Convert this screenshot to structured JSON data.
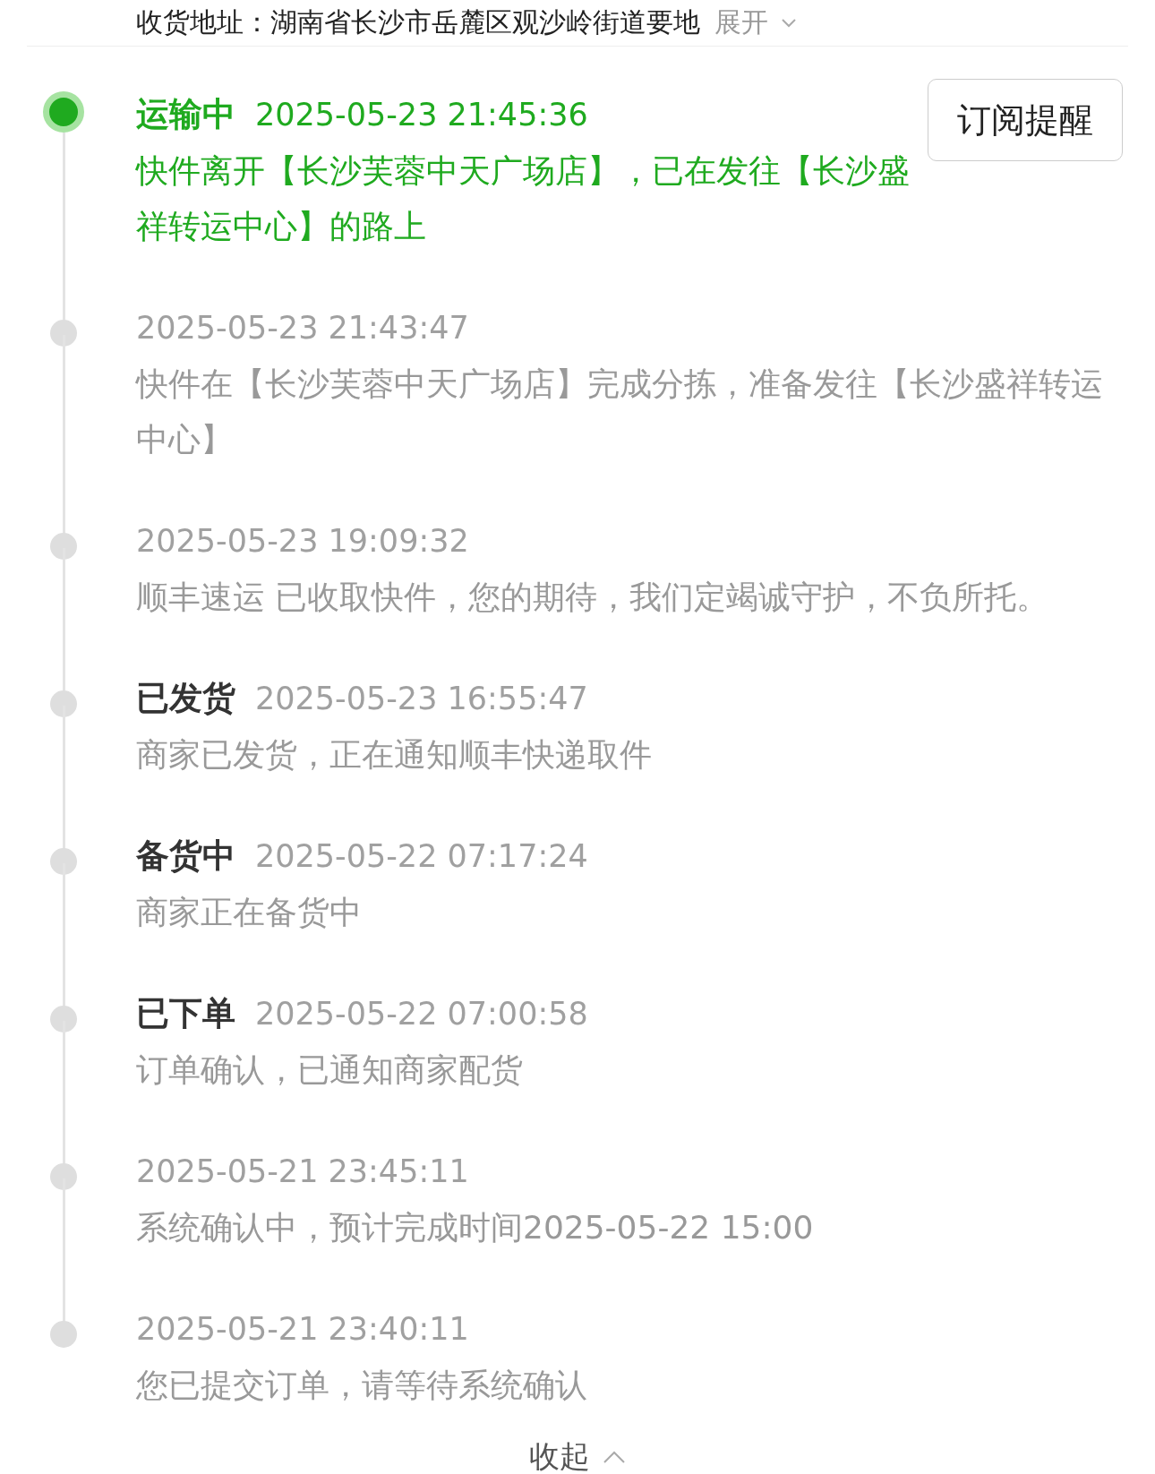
{
  "address": {
    "text": "收货地址：湖南省长沙市岳麓区观沙岭街道要地",
    "expand": "展开"
  },
  "subscribe_button": "订阅提醒",
  "events": [
    {
      "status": "运输中",
      "time": "2025-05-23 21:45:36",
      "description": "快件离开【长沙芙蓉中天广场店】，已在发往【长沙盛祥转运中心】的路上",
      "selected": true
    },
    {
      "time": "2025-05-23 21:43:47",
      "description": "快件在【长沙芙蓉中天广场店】完成分拣，准备发往【长沙盛祥转运中心】",
      "selected": false
    },
    {
      "time": "2025-05-23 19:09:32",
      "description": "顺丰速运 已收取快件，您的期待，我们定竭诚守护，不负所托。",
      "selected": false
    },
    {
      "status": "已发货",
      "time": "2025-05-23 16:55:47",
      "description": "商家已发货，正在通知顺丰快递取件",
      "selected": false
    },
    {
      "status": "备货中",
      "time": "2025-05-22 07:17:24",
      "description": "商家正在备货中",
      "selected": false
    },
    {
      "status": "已下单",
      "time": "2025-05-22 07:00:58",
      "description": "订单确认，已通知商家配货",
      "selected": false
    },
    {
      "time": "2025-05-21 23:45:11",
      "description": "系统确认中，预计完成时间2025-05-22 15:00",
      "selected": false
    },
    {
      "time": "2025-05-21 23:40:11",
      "description": "您已提交订单，请等待系统确认",
      "selected": false
    }
  ],
  "collapse": "收起"
}
